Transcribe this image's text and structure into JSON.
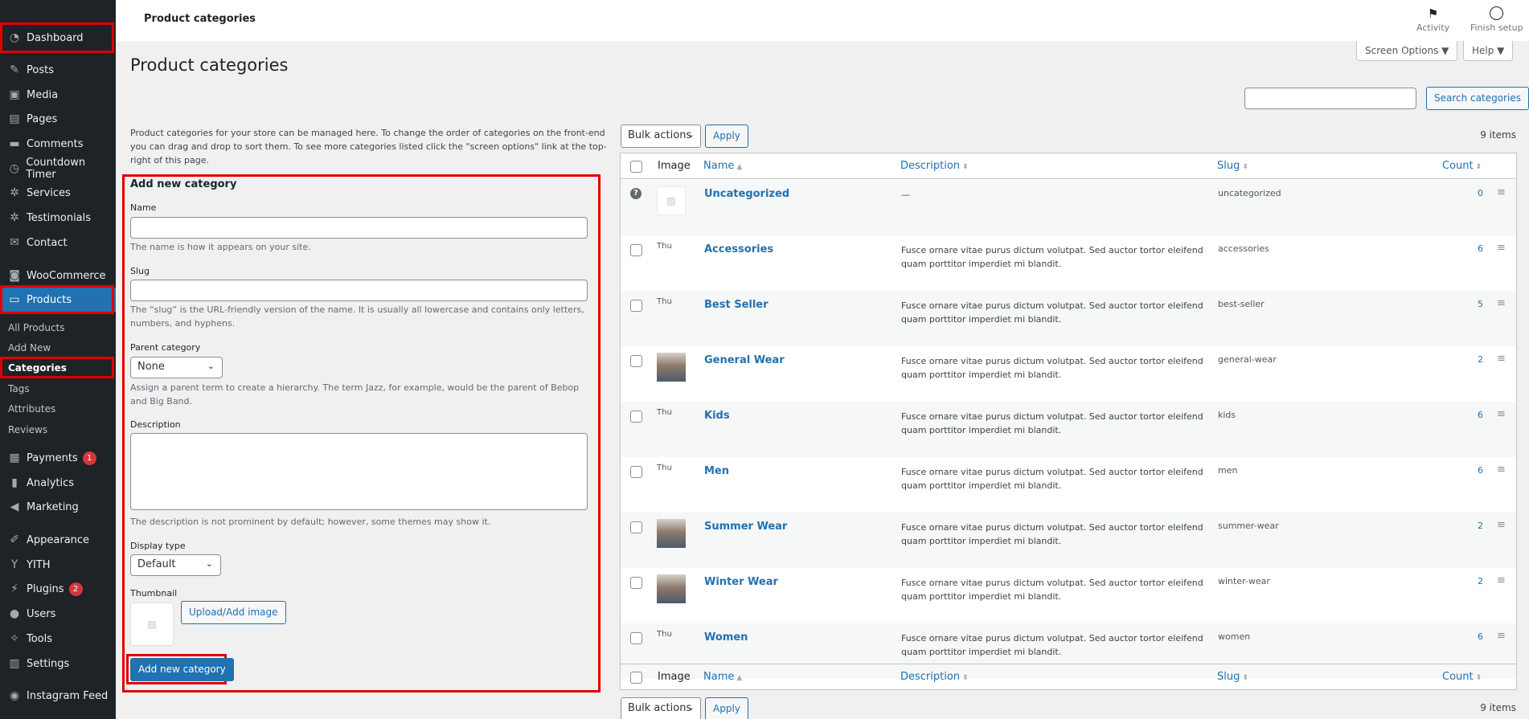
{
  "sidebar": {
    "items": [
      {
        "label": "Dashboard",
        "icon": "dashboard-icon"
      },
      {
        "label": "Posts",
        "icon": "pin-icon"
      },
      {
        "label": "Media",
        "icon": "media-icon"
      },
      {
        "label": "Pages",
        "icon": "page-icon"
      },
      {
        "label": "Comments",
        "icon": "comment-icon"
      },
      {
        "label": "Countdown Timer",
        "icon": "clock-icon"
      },
      {
        "label": "Services",
        "icon": "gear-icon"
      },
      {
        "label": "Testimonials",
        "icon": "gear-icon"
      },
      {
        "label": "Contact",
        "icon": "mail-icon"
      },
      {
        "label": "WooCommerce",
        "icon": "woo-icon"
      },
      {
        "label": "Products",
        "icon": "archive-icon"
      },
      {
        "label": "Payments",
        "icon": "money-icon",
        "badge": "1"
      },
      {
        "label": "Analytics",
        "icon": "bar-chart-icon"
      },
      {
        "label": "Marketing",
        "icon": "megaphone-icon"
      },
      {
        "label": "Appearance",
        "icon": "brush-icon"
      },
      {
        "label": "YITH",
        "icon": "yith-icon"
      },
      {
        "label": "Plugins",
        "icon": "plug-icon",
        "badge": "2"
      },
      {
        "label": "Users",
        "icon": "user-icon"
      },
      {
        "label": "Tools",
        "icon": "wrench-icon"
      },
      {
        "label": "Settings",
        "icon": "settings-icon"
      },
      {
        "label": "Instagram Feed",
        "icon": "instagram-icon"
      }
    ],
    "submenu": [
      "All Products",
      "Add New",
      "Categories",
      "Tags",
      "Attributes",
      "Reviews"
    ]
  },
  "topbar": {
    "title": "Product categories",
    "activity": "Activity",
    "finish_setup": "Finish setup"
  },
  "screen_options": "Screen Options ▼",
  "help": "Help ▼",
  "page_title": "Product categories",
  "search": {
    "button": "Search categories",
    "value": ""
  },
  "form": {
    "intro": "Product categories for your store can be managed here. To change the order of categories on the front-end you can drag and drop to sort them. To see more categories listed click the \"screen options\" link at the top-right of this page.",
    "title": "Add new category",
    "name_label": "Name",
    "name_help": "The name is how it appears on your site.",
    "slug_label": "Slug",
    "slug_help": "The “slug” is the URL-friendly version of the name. It is usually all lowercase and contains only letters, numbers, and hyphens.",
    "parent_label": "Parent category",
    "parent_value": "None",
    "parent_help": "Assign a parent term to create a hierarchy. The term Jazz, for example, would be the parent of Bebop and Big Band.",
    "description_label": "Description",
    "description_help": "The description is not prominent by default; however, some themes may show it.",
    "display_type_label": "Display type",
    "display_type_value": "Default",
    "thumbnail_label": "Thumbnail",
    "upload_button": "Upload/Add image",
    "submit_button": "Add new category"
  },
  "table": {
    "bulk_actions": "Bulk actions",
    "apply": "Apply",
    "items_count": "9 items",
    "columns": {
      "image": "Image",
      "name": "Name",
      "description": "Description",
      "slug": "Slug",
      "count": "Count"
    },
    "rows": [
      {
        "name": "Uncategorized",
        "description": "—",
        "slug": "uncategorized",
        "count": "0",
        "thumb": "placeholder"
      },
      {
        "name": "Accessories",
        "description": "Fusce ornare vitae purus dictum volutpat. Sed auctor tortor eleifend quam porttitor imperdiet mi blandit.",
        "slug": "accessories",
        "count": "6",
        "thumb": "broken"
      },
      {
        "name": "Best Seller",
        "description": "Fusce ornare vitae purus dictum volutpat. Sed auctor tortor eleifend quam porttitor imperdiet mi blandit.",
        "slug": "best-seller",
        "count": "5",
        "thumb": "broken"
      },
      {
        "name": "General Wear",
        "description": "Fusce ornare vitae purus dictum volutpat. Sed auctor tortor eleifend quam porttitor imperdiet mi blandit.",
        "slug": "general-wear",
        "count": "2",
        "thumb": "photo"
      },
      {
        "name": "Kids",
        "description": "Fusce ornare vitae purus dictum volutpat. Sed auctor tortor eleifend quam porttitor imperdiet mi blandit.",
        "slug": "kids",
        "count": "6",
        "thumb": "broken"
      },
      {
        "name": "Men",
        "description": "Fusce ornare vitae purus dictum volutpat. Sed auctor tortor eleifend quam porttitor imperdiet mi blandit.",
        "slug": "men",
        "count": "6",
        "thumb": "broken"
      },
      {
        "name": "Summer Wear",
        "description": "Fusce ornare vitae purus dictum volutpat. Sed auctor tortor eleifend quam porttitor imperdiet mi blandit.",
        "slug": "summer-wear",
        "count": "2",
        "thumb": "photo"
      },
      {
        "name": "Winter Wear",
        "description": "Fusce ornare vitae purus dictum volutpat. Sed auctor tortor eleifend quam porttitor imperdiet mi blandit.",
        "slug": "winter-wear",
        "count": "2",
        "thumb": "photo"
      },
      {
        "name": "Women",
        "description": "Fusce ornare vitae purus dictum volutpat. Sed auctor tortor eleifend quam porttitor imperdiet mi blandit.",
        "slug": "women",
        "count": "6",
        "thumb": "broken"
      }
    ],
    "broken_thumb_text": "Thu"
  },
  "colors": {
    "accent": "#2271b1",
    "sidebar_bg": "#1d2327",
    "highlight_box": "#e00000",
    "badge": "#d63638"
  }
}
